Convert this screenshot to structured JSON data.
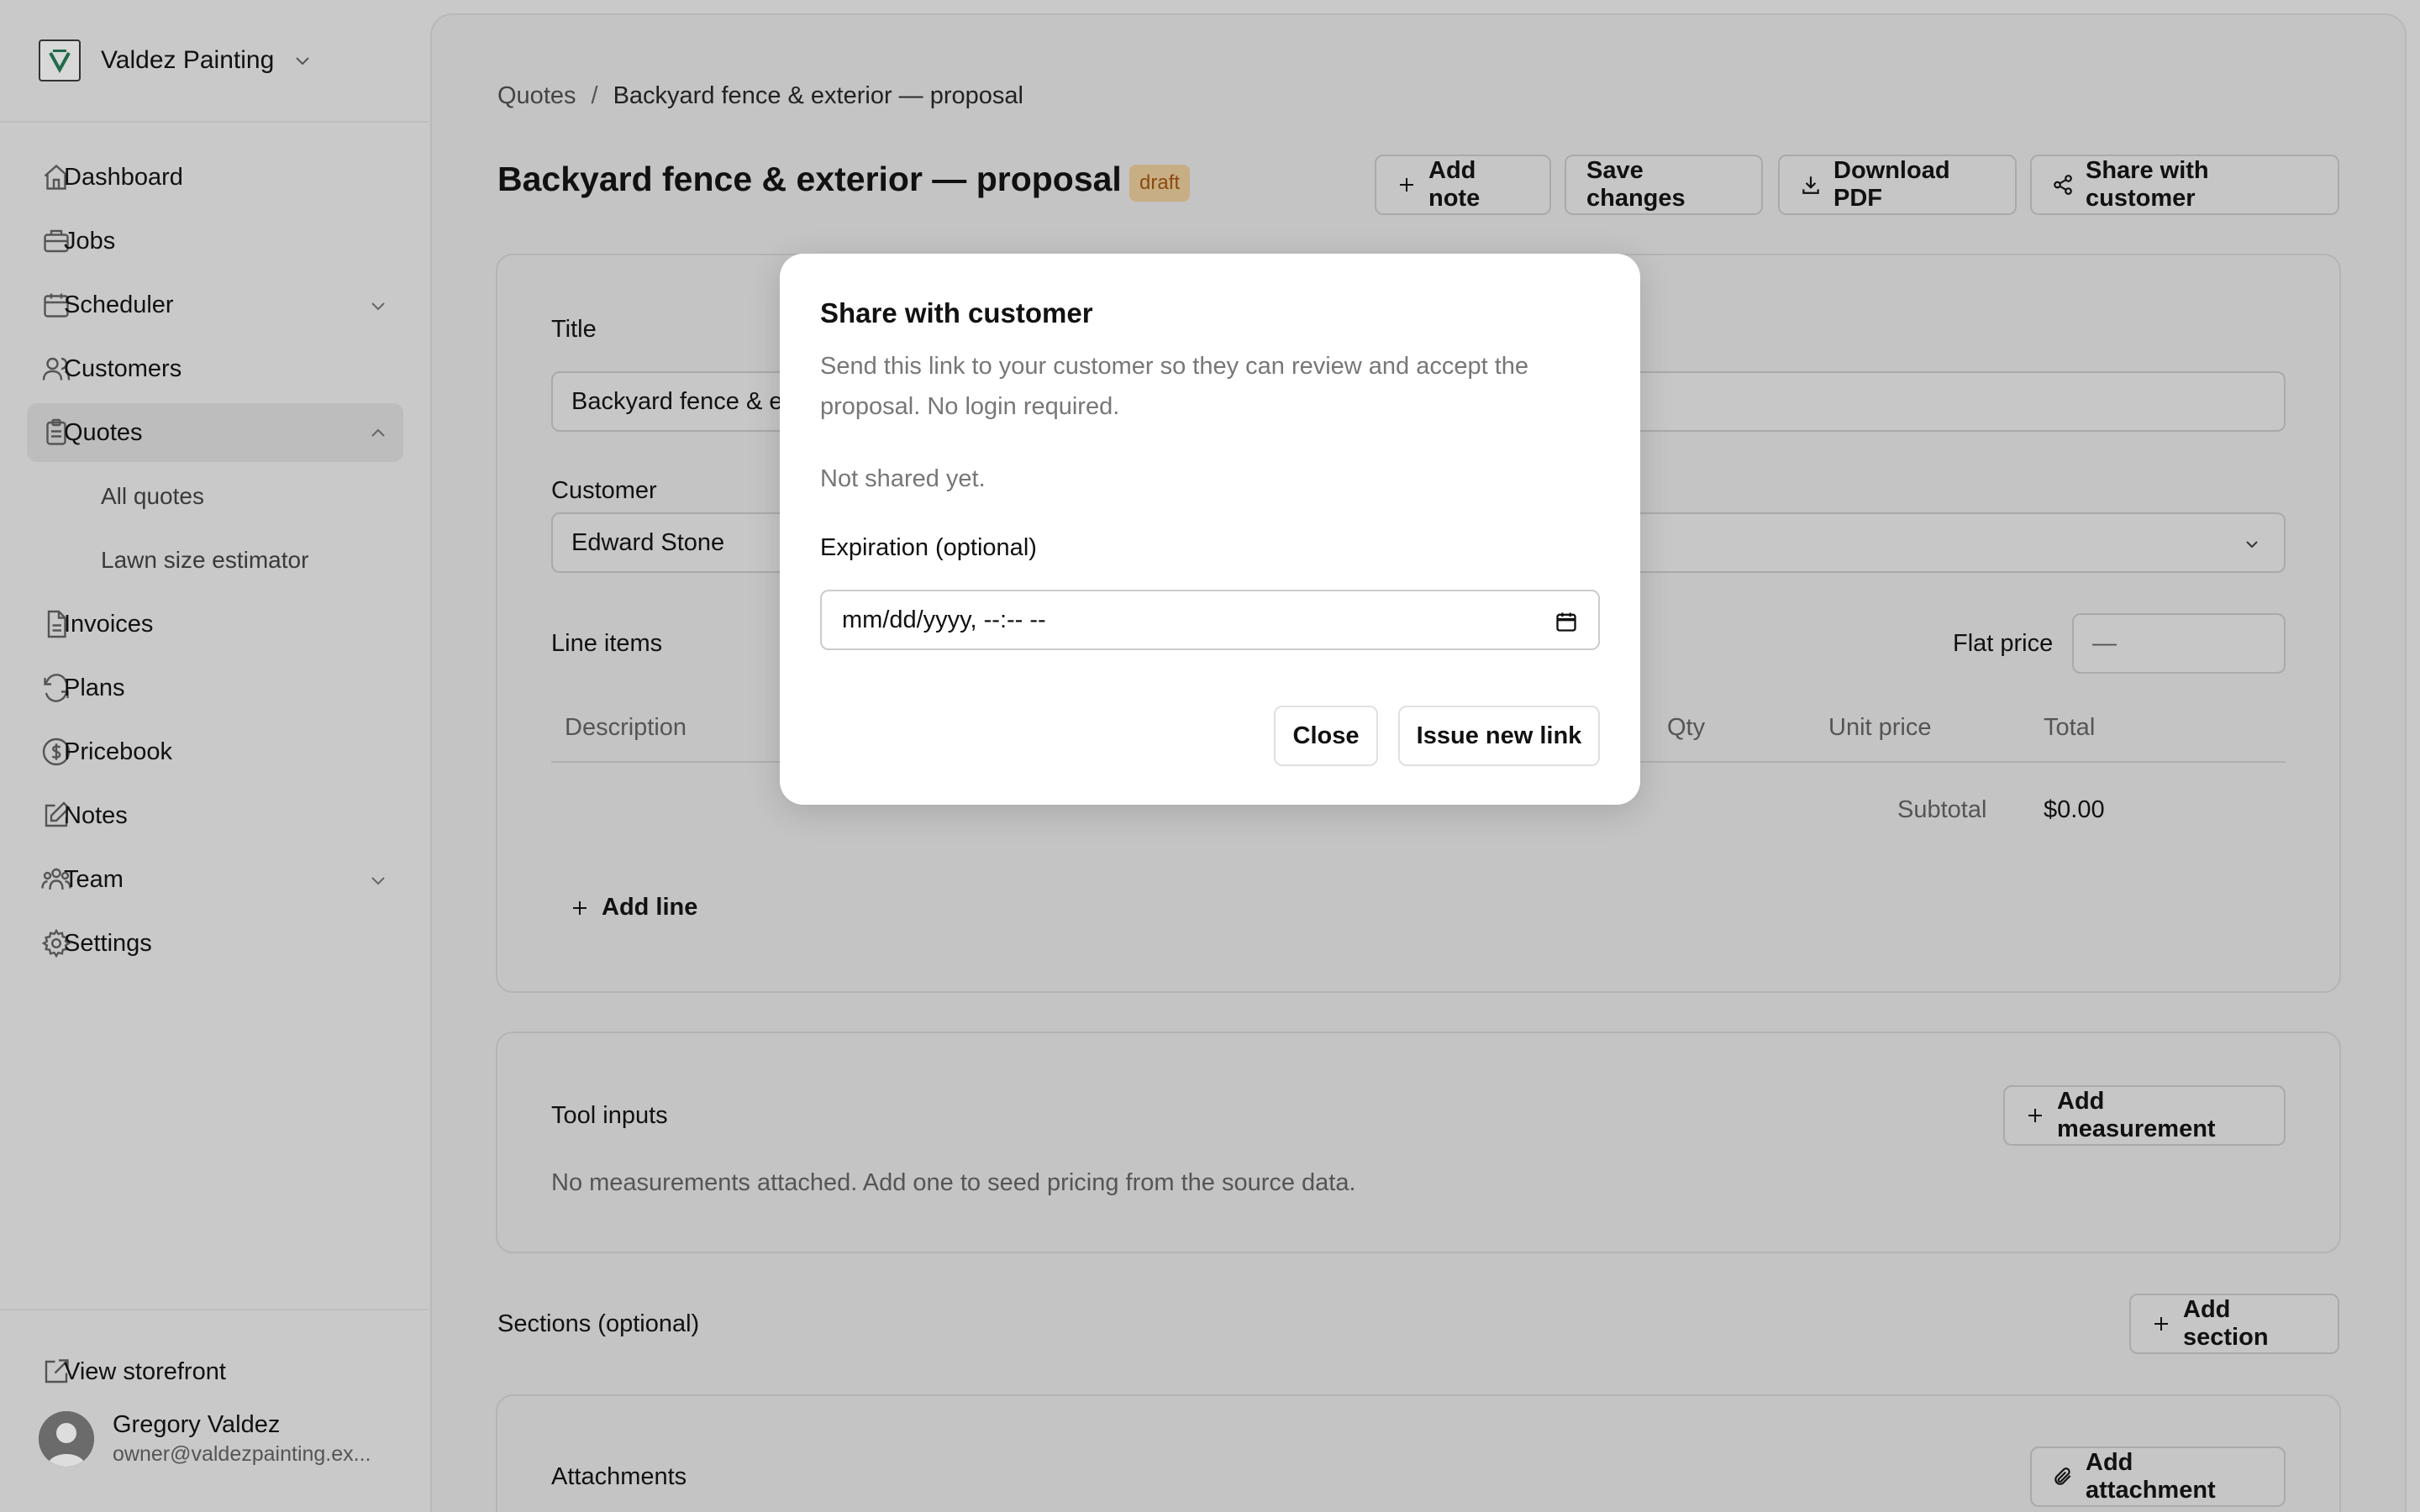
{
  "sidebar": {
    "brand": {
      "name": "Valdez Painting",
      "logo_icon": "paint-roller-icon"
    },
    "nav": [
      {
        "label": "Dashboard",
        "icon": "home-icon"
      },
      {
        "label": "Jobs",
        "icon": "briefcase-icon"
      },
      {
        "label": "Scheduler",
        "icon": "calendar-icon",
        "expandable": true
      },
      {
        "label": "Customers",
        "icon": "users-icon"
      },
      {
        "label": "Quotes",
        "icon": "clipboard-icon",
        "active": true,
        "expanded": true,
        "children": [
          {
            "label": "All quotes"
          },
          {
            "label": "Lawn size estimator"
          }
        ]
      },
      {
        "label": "Invoices",
        "icon": "file-icon"
      },
      {
        "label": "Plans",
        "icon": "refresh-icon"
      },
      {
        "label": "Pricebook",
        "icon": "dollar-icon"
      },
      {
        "label": "Notes",
        "icon": "pencil-icon"
      },
      {
        "label": "Team",
        "icon": "team-icon",
        "expandable": true
      },
      {
        "label": "Settings",
        "icon": "gear-icon"
      }
    ],
    "footer": {
      "storefront_label": "View storefront"
    },
    "user": {
      "name": "Gregory Valdez",
      "email": "owner@valdezpainting.ex..."
    }
  },
  "breadcrumb": {
    "parent": "Quotes",
    "separator": "/",
    "current": "Backyard fence & exterior — proposal"
  },
  "header": {
    "title": "Backyard fence & exterior — proposal",
    "status_badge": "draft",
    "buttons": {
      "add_note": "Add note",
      "save": "Save changes",
      "download": "Download PDF",
      "share": "Share with customer"
    }
  },
  "form": {
    "title_label": "Title",
    "title_value": "Backyard fence & e",
    "customer_label": "Customer",
    "customer_value": "Edward Stone",
    "line_items_label": "Line items",
    "flat_price_label": "Flat price",
    "flat_price_value": "—",
    "columns": [
      "Description",
      "Qty",
      "Unit price",
      "Total"
    ],
    "subtotal_label": "Subtotal",
    "subtotal_value": "$0.00",
    "add_line": "Add line"
  },
  "tool_inputs": {
    "heading": "Tool inputs",
    "add_button": "Add measurement",
    "empty_text": "No measurements attached. Add one to seed pricing from the source data."
  },
  "sections": {
    "heading": "Sections (optional)",
    "add_button": "Add section"
  },
  "attachments": {
    "heading": "Attachments",
    "add_button": "Add attachment"
  },
  "modal": {
    "title": "Share with customer",
    "description": "Send this link to your customer so they can review and accept the proposal. No login required.",
    "status": "Not shared yet.",
    "expiration_label": "Expiration (optional)",
    "expiration_placeholder": "mm/dd/yyyy, --:-- --",
    "close_label": "Close",
    "issue_label": "Issue new link"
  },
  "colors": {
    "badge_bg": "#c8ae84",
    "badge_text": "#8a4a10",
    "modal_bg": "#ffffff"
  }
}
